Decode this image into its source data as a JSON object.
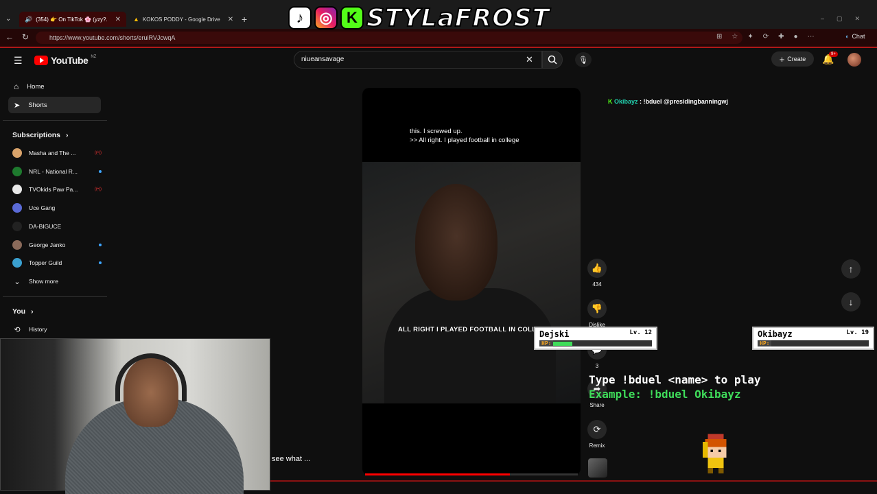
{
  "browser": {
    "tabs": [
      {
        "label": "(354) 👉 On TikTok 🌸 (yzy?...",
        "active": true
      },
      {
        "label": "KOKOS PODDY - Google Drive",
        "active": false
      }
    ],
    "url": "https://www.youtube.com/shorts/eruiRVJcwqA",
    "chat_label": "Chat"
  },
  "banner": {
    "title": "STYLaFROST",
    "k_letter": "K"
  },
  "header": {
    "logo_text": "YouTube",
    "region": "NZ",
    "search_value": "niueansavage",
    "create_label": "Create",
    "notif_badge": "9+"
  },
  "sidebar": {
    "main": [
      {
        "label": "Home"
      },
      {
        "label": "Shorts"
      }
    ],
    "subscriptions_title": "Subscriptions",
    "subscriptions": [
      {
        "label": "Masha and The ...",
        "indicator": "live",
        "color": "#d9a36b"
      },
      {
        "label": "NRL - National R...",
        "indicator": "dot",
        "color": "#1e7a2e"
      },
      {
        "label": "TVOkids Paw Pa...",
        "indicator": "live",
        "color": "#e8e8e8"
      },
      {
        "label": "Uce Gang",
        "indicator": "none",
        "color": "#5a6ad6"
      },
      {
        "label": "DA-BIGUCE",
        "indicator": "none",
        "color": "#222222"
      },
      {
        "label": "George Janko",
        "indicator": "dot",
        "color": "#8a6a5a"
      },
      {
        "label": "Topper Guild",
        "indicator": "dot",
        "color": "#3aa0d0"
      }
    ],
    "show_more": "Show more",
    "you_title": "You",
    "history": "History"
  },
  "short": {
    "caption_line1": "this. I screwed up.",
    "caption_line2": ">> All right. I played football in college",
    "burned_subtitle": "ALL RIGHT I PLAYED FOOTBALL IN COLL",
    "description_preview": "see what ...",
    "progress": 0.68
  },
  "actions": {
    "likes": "434",
    "dislike": "Dislike",
    "comments": "3",
    "share": "Share",
    "remix": "Remix"
  },
  "chat_overlay": {
    "name": "Okibayz",
    "message": ": !bduel @presidingbanningwj"
  },
  "duel": {
    "player1": {
      "name": "Dejski",
      "level": "Lv. 12",
      "hp_label": "HP:",
      "hp": 0.2
    },
    "player2": {
      "name": "Okibayz",
      "level": "Lv. 19",
      "hp_label": "HP:",
      "hp": 0.0
    },
    "line1": "Type !bduel <name> to play",
    "line2": "Example: !bduel Okibayz"
  }
}
